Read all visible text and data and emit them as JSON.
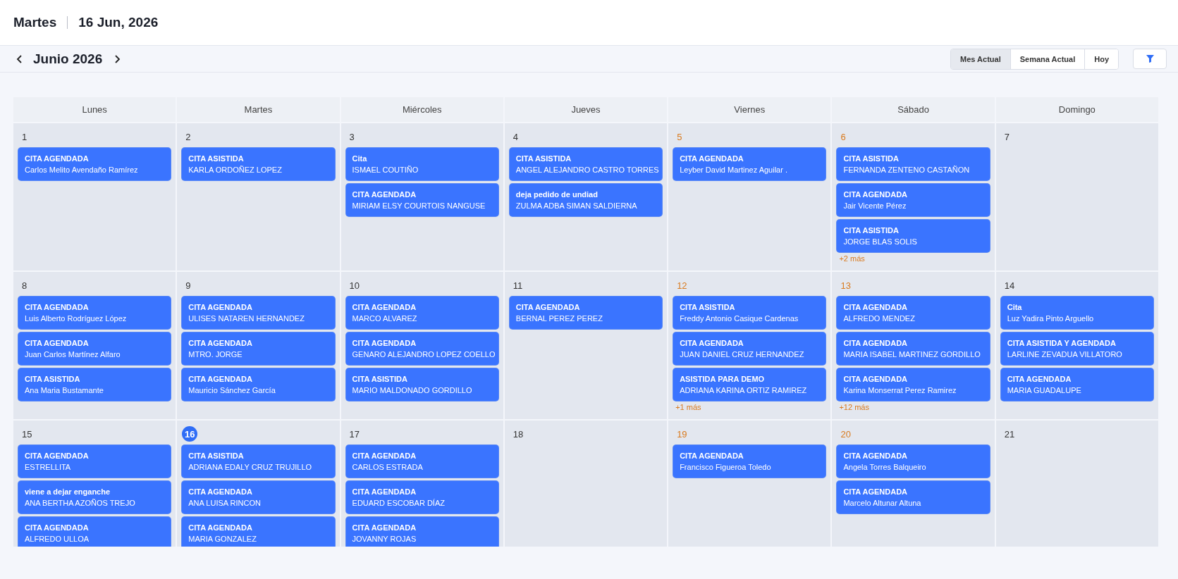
{
  "header": {
    "weekday": "Martes",
    "date": "16 Jun, 2026"
  },
  "nav": {
    "month": "Junio 2026",
    "views": [
      {
        "label": "Mes Actual",
        "selected": true
      },
      {
        "label": "Semana Actual",
        "selected": false
      },
      {
        "label": "Hoy",
        "selected": false
      }
    ]
  },
  "calendar": {
    "weekdays": [
      "Lunes",
      "Martes",
      "Miércoles",
      "Jueves",
      "Viernes",
      "Sábado",
      "Domingo"
    ],
    "weeks": [
      {
        "days": [
          {
            "number": "1",
            "accent": false,
            "selected": false,
            "events": [
              {
                "title": "CITA AGENDADA",
                "name": "Carlos Melito Avendaño Ramírez"
              }
            ]
          },
          {
            "number": "2",
            "accent": false,
            "selected": false,
            "events": [
              {
                "title": "CITA ASISTIDA",
                "name": "KARLA ORDOÑEZ LOPEZ"
              }
            ]
          },
          {
            "number": "3",
            "accent": false,
            "selected": false,
            "events": [
              {
                "title": "Cita",
                "name": "ISMAEL COUTIÑO"
              },
              {
                "title": "CITA AGENDADA",
                "name": "MIRIAM ELSY COURTOIS NANGUSE"
              }
            ]
          },
          {
            "number": "4",
            "accent": false,
            "selected": false,
            "events": [
              {
                "title": "CITA ASISTIDA",
                "name": "ANGEL ALEJANDRO CASTRO TORRES"
              },
              {
                "title": "deja pedido de undiad",
                "name": "ZULMA ADBA SIMAN SALDIERNA"
              }
            ]
          },
          {
            "number": "5",
            "accent": true,
            "selected": false,
            "events": [
              {
                "title": "CITA AGENDADA",
                "name": "Leyber David Martinez Aguilar ."
              }
            ]
          },
          {
            "number": "6",
            "accent": true,
            "selected": false,
            "events": [
              {
                "title": "CITA ASISTIDA",
                "name": "FERNANDA ZENTENO CASTAÑON"
              },
              {
                "title": "CITA AGENDADA",
                "name": "Jair Vicente Pérez"
              },
              {
                "title": "CITA ASISTIDA",
                "name": "JORGE BLAS SOLIS"
              }
            ],
            "more": "+2 más"
          },
          {
            "number": "7",
            "accent": false,
            "selected": false
          }
        ]
      },
      {
        "days": [
          {
            "number": "8",
            "accent": false,
            "selected": false,
            "events": [
              {
                "title": "CITA AGENDADA",
                "name": "Luis Alberto Rodríguez López"
              },
              {
                "title": "CITA AGENDADA",
                "name": "Juan Carlos Martínez Alfaro"
              },
              {
                "title": "CITA ASISTIDA",
                "name": "Ana Maria Bustamante"
              }
            ]
          },
          {
            "number": "9",
            "accent": false,
            "selected": false,
            "events": [
              {
                "title": "CITA AGENDADA",
                "name": "ULISES NATAREN HERNANDEZ"
              },
              {
                "title": "CITA AGENDADA",
                "name": "MTRO. JORGE"
              },
              {
                "title": "CITA AGENDADA",
                "name": "Mauricio Sánchez García"
              }
            ]
          },
          {
            "number": "10",
            "accent": false,
            "selected": false,
            "events": [
              {
                "title": "CITA AGENDADA",
                "name": "MARCO ALVAREZ"
              },
              {
                "title": "CITA AGENDADA",
                "name": "GENARO ALEJANDRO LOPEZ COELLO"
              },
              {
                "title": "CITA ASISTIDA",
                "name": "MARIO MALDONADO GORDILLO"
              }
            ]
          },
          {
            "number": "11",
            "accent": false,
            "selected": false,
            "events": [
              {
                "title": "CITA AGENDADA",
                "name": "BERNAL PEREZ PEREZ"
              }
            ]
          },
          {
            "number": "12",
            "accent": true,
            "selected": false,
            "events": [
              {
                "title": "CITA ASISTIDA",
                "name": "Freddy Antonio Casique Cardenas"
              },
              {
                "title": "CITA AGENDADA",
                "name": "JUAN DANIEL CRUZ HERNANDEZ"
              },
              {
                "title": "ASISTIDA PARA DEMO",
                "name": "ADRIANA KARINA ORTIZ RAMIREZ"
              }
            ],
            "more": "+1 más"
          },
          {
            "number": "13",
            "accent": true,
            "selected": false,
            "events": [
              {
                "title": "CITA AGENDADA",
                "name": "ALFREDO MENDEZ"
              },
              {
                "title": "CITA AGENDADA",
                "name": "MARIA ISABEL MARTINEZ GORDILLO"
              },
              {
                "title": "CITA AGENDADA",
                "name": "Karina Monserrat Perez Ramirez"
              }
            ],
            "more": "+12 más"
          },
          {
            "number": "14",
            "accent": false,
            "selected": false,
            "events": [
              {
                "title": "Cita",
                "name": "Luz Yadira Pinto Arguello"
              },
              {
                "title": "CITA ASISTIDA Y AGENDADA",
                "name": "LARLINE ZEVADUA VILLATORO"
              },
              {
                "title": "CITA AGENDADA",
                "name": "MARIA GUADALUPE"
              }
            ]
          }
        ]
      },
      {
        "days": [
          {
            "number": "15",
            "accent": false,
            "selected": false,
            "events": [
              {
                "title": "CITA AGENDADA",
                "name": "ESTRELLITA"
              },
              {
                "title": "viene a dejar enganche",
                "name": "ANA BERTHA AZOÑOS TREJO"
              },
              {
                "title": "CITA AGENDADA",
                "name": "ALFREDO ULLOA"
              }
            ]
          },
          {
            "number": "16",
            "accent": false,
            "selected": true,
            "events": [
              {
                "title": "CITA ASISTIDA",
                "name": "ADRIANA EDALY CRUZ TRUJILLO"
              },
              {
                "title": "CITA AGENDADA",
                "name": "ANA LUISA RINCON"
              },
              {
                "title": "CITA AGENDADA",
                "name": "MARIA GONZALEZ"
              }
            ]
          },
          {
            "number": "17",
            "accent": false,
            "selected": false,
            "events": [
              {
                "title": "CITA AGENDADA",
                "name": "CARLOS ESTRADA"
              },
              {
                "title": "CITA AGENDADA",
                "name": "EDUARD ESCOBAR DÍAZ"
              },
              {
                "title": "CITA AGENDADA",
                "name": "JOVANNY ROJAS"
              }
            ]
          },
          {
            "number": "18",
            "accent": false,
            "selected": false
          },
          {
            "number": "19",
            "accent": true,
            "selected": false,
            "events": [
              {
                "title": "CITA AGENDADA",
                "name": "Francisco Figueroa Toledo"
              }
            ]
          },
          {
            "number": "20",
            "accent": true,
            "selected": false,
            "events": [
              {
                "title": "CITA AGENDADA",
                "name": "Angela Torres Balqueiro"
              },
              {
                "title": "CITA AGENDADA",
                "name": "Marcelo Altunar Altuna"
              }
            ]
          },
          {
            "number": "21",
            "accent": false,
            "selected": false
          }
        ]
      }
    ]
  }
}
